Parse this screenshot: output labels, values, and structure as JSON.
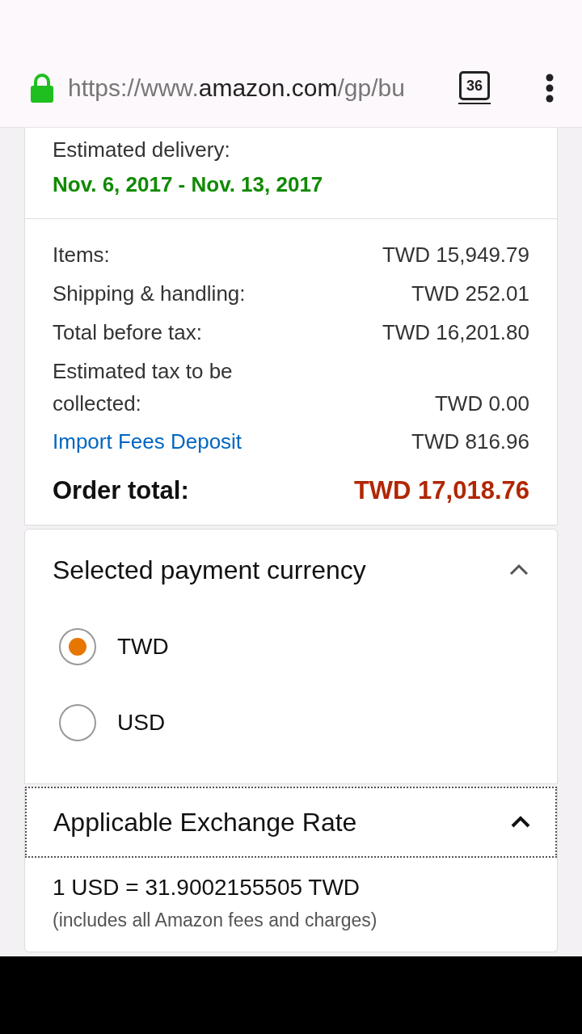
{
  "browser": {
    "url": {
      "prefix": "https://www.",
      "host": "amazon.com",
      "path": "/gp/bu"
    },
    "tab_count": "36"
  },
  "delivery": {
    "label": "Estimated delivery:",
    "dates": "Nov. 6, 2017 - Nov. 13, 2017"
  },
  "summary": {
    "rows": [
      {
        "kind": "plain",
        "label": "Items:",
        "value": "TWD 15,949.79"
      },
      {
        "kind": "plain",
        "label": "Shipping & handling:",
        "value": "TWD 252.01"
      },
      {
        "kind": "plain",
        "label": "Total before tax:",
        "value": "TWD 16,201.80"
      },
      {
        "kind": "plain",
        "label": "Estimated tax to be collected:",
        "value": "TWD 0.00"
      },
      {
        "kind": "link",
        "label": "Import Fees Deposit",
        "value": "TWD 816.96"
      }
    ],
    "total": {
      "label": "Order total:",
      "value": "TWD 17,018.76"
    }
  },
  "currency": {
    "title": "Selected payment currency",
    "expanded": true,
    "options": [
      {
        "label": "TWD",
        "selected": true
      },
      {
        "label": "USD",
        "selected": false
      }
    ]
  },
  "exchange": {
    "title": "Applicable Exchange Rate",
    "expanded": true,
    "rate": "1 USD = 31.9002155505 TWD",
    "note": "(includes all Amazon fees and charges)"
  }
}
